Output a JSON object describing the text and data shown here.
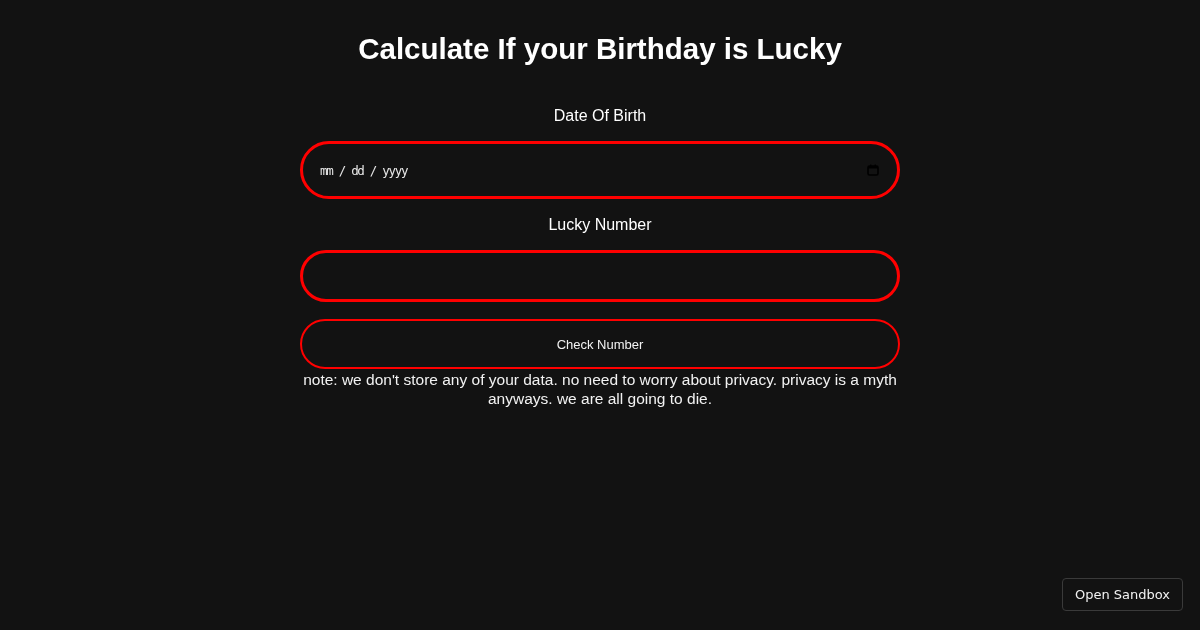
{
  "page": {
    "title": "Calculate If your Birthday is Lucky"
  },
  "form": {
    "fields": [
      {
        "kind": "date",
        "label": "Date Of Birth",
        "placeholder": "mm / dd / yyyy"
      },
      {
        "kind": "number",
        "label": "Lucky Number"
      }
    ],
    "submit_button": "Check Number",
    "note": "note: we don't store any of your data. no need to worry about privacy. privacy is a myth anyways. we are all going to die."
  },
  "sandbox_button": "Open Sandbox"
}
